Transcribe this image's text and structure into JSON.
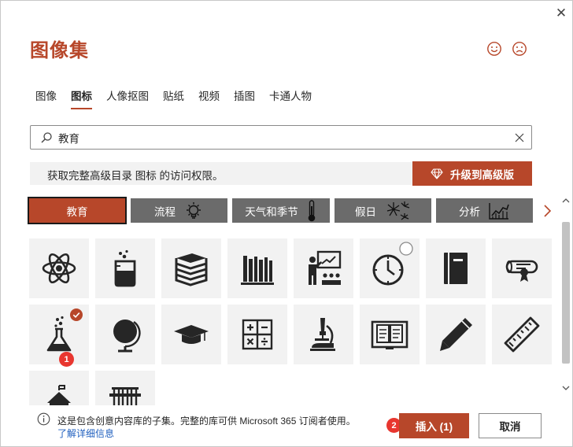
{
  "dialog": {
    "title": "图像集",
    "close_symbol": "✕"
  },
  "tabs": [
    {
      "label": "图像",
      "active": false
    },
    {
      "label": "图标",
      "active": true
    },
    {
      "label": "人像抠图",
      "active": false
    },
    {
      "label": "贴纸",
      "active": false
    },
    {
      "label": "视频",
      "active": false
    },
    {
      "label": "插图",
      "active": false
    },
    {
      "label": "卡通人物",
      "active": false
    }
  ],
  "search": {
    "value": "教育",
    "placeholder": ""
  },
  "upgrade": {
    "message": "获取完整高级目录 图标 的访问权限。",
    "button_label": "升级到高级版"
  },
  "categories": [
    {
      "label": "教育",
      "icon": "",
      "active": true
    },
    {
      "label": "流程",
      "icon": "lightbulb-icon",
      "active": false
    },
    {
      "label": "天气和季节",
      "icon": "thermometer-icon",
      "active": false
    },
    {
      "label": "假日",
      "icon": "fireworks-icon",
      "active": false
    },
    {
      "label": "分析",
      "icon": "line-chart-icon",
      "active": false
    }
  ],
  "icons": [
    {
      "name": "atom-icon",
      "selected": false
    },
    {
      "name": "beaker-icon",
      "selected": false
    },
    {
      "name": "book-stack-icon",
      "selected": false
    },
    {
      "name": "bookshelf-icon",
      "selected": false
    },
    {
      "name": "teacher-classroom-icon",
      "selected": false
    },
    {
      "name": "clock-icon",
      "selected": false
    },
    {
      "name": "notebook-icon",
      "selected": false
    },
    {
      "name": "diploma-icon",
      "selected": false
    },
    {
      "name": "flask-icon",
      "selected": true
    },
    {
      "name": "globe-icon",
      "selected": false
    },
    {
      "name": "graduation-cap-icon",
      "selected": false
    },
    {
      "name": "calculator-icon",
      "selected": false
    },
    {
      "name": "microscope-icon",
      "selected": false
    },
    {
      "name": "open-book-icon",
      "selected": false
    },
    {
      "name": "pencil-icon",
      "selected": false
    },
    {
      "name": "ruler-icon",
      "selected": false
    },
    {
      "name": "school-icon",
      "selected": false
    },
    {
      "name": "test-tubes-icon",
      "selected": false
    }
  ],
  "badges": {
    "step1": "1",
    "step2": "2"
  },
  "footer": {
    "info": "这是包含创意内容库的子集。完整的库可供 Microsoft 365 订阅者使用。",
    "link": "了解详细信息",
    "insert_label": "插入 (1)",
    "cancel_label": "取消"
  },
  "colors": {
    "accent": "#b7472a",
    "category_inactive": "#6b6b6b",
    "tile_bg": "#f2f2f2",
    "icon": "#262626",
    "badge": "#e8362f",
    "link": "#1f5fbf"
  }
}
